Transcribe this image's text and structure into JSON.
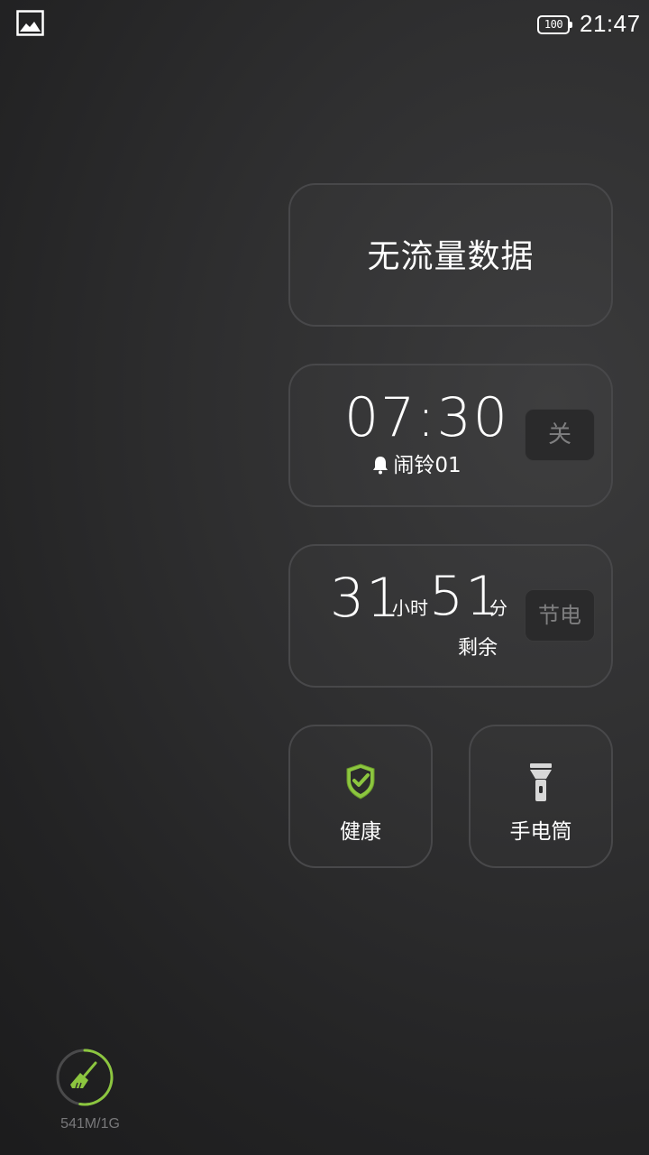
{
  "status_bar": {
    "battery_level": "100",
    "time": "21:47",
    "notification_icon": "gallery-icon"
  },
  "data_card": {
    "text": "无流量数据"
  },
  "alarm_card": {
    "time": "07:30",
    "label": "闹铃01",
    "bell_icon": "bell-icon",
    "toggle_label": "关"
  },
  "battery_card": {
    "hours": "31",
    "hours_unit": "小时",
    "minutes": "51",
    "minutes_unit": "分",
    "remaining_label": "剩余",
    "button_label": "节电"
  },
  "shortcuts": {
    "health": {
      "label": "健康",
      "icon": "shield-check-icon",
      "color": "#8cc63f"
    },
    "flashlight": {
      "label": "手电筒",
      "icon": "flashlight-icon"
    }
  },
  "memory_cleaner": {
    "icon": "broom-icon",
    "text": "541M/1G",
    "used_mb": 541,
    "total_gb": 1,
    "accent_color": "#8cc63f"
  }
}
